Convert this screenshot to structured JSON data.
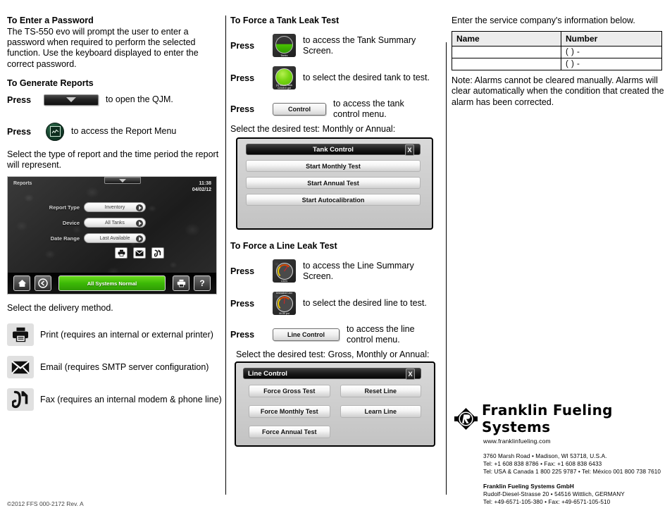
{
  "col1": {
    "password": {
      "heading": "To Enter a Password",
      "body": "The TS-550 evo will prompt the user to enter a password when required to perform the selected function. Use the keyboard displayed to enter the correct password."
    },
    "reports": {
      "heading": "To Generate Reports",
      "press1_label": "Press",
      "press1_after": "to open the QJM.",
      "press2_label": "Press",
      "press2_after": "to access the Report Menu",
      "select_text": "Select the type of report and the time period the report will represent.",
      "delivery_intro": "Select the delivery method."
    },
    "screenshot": {
      "title": "Reports",
      "time": "11:38",
      "date": "04/02/12",
      "fields": [
        {
          "label": "Report Type",
          "value": "Inventory"
        },
        {
          "label": "Device",
          "value": "All Tanks"
        },
        {
          "label": "Date Range",
          "value": "Last Available"
        }
      ],
      "actions": [
        "print-icon",
        "email-icon",
        "fax-icon"
      ],
      "status": "All Systems Normal",
      "bar_buttons": [
        "home-icon",
        "back-icon",
        "status",
        "print-icon",
        "help-icon"
      ],
      "help_label": "?"
    },
    "delivery": [
      {
        "icon": "print-icon",
        "text": "Print (requires an internal or external printer)"
      },
      {
        "icon": "email-icon",
        "text": "Email (requires SMTP server configuration)"
      },
      {
        "icon": "fax-icon",
        "text": "Fax (requires an internal modem & phone line)"
      }
    ]
  },
  "col2": {
    "tank": {
      "heading": "To Force a Tank Leak Test",
      "steps": [
        {
          "label": "Press",
          "after": "to access the Tank Summary Screen."
        },
        {
          "label": "Press",
          "after": "to select the desired tank to test."
        },
        {
          "label": "Press",
          "after": "to access the tank control menu."
        }
      ],
      "tank_icon_caption": "Tanks",
      "tank_sel_caption_top": "(1) West Tank",
      "tank_sel_caption_bottom": "12345.6 gal",
      "control_button": "Control",
      "select_text": "Select the desired test: Monthly or Annual:",
      "dialog": {
        "title": "Tank Control",
        "close": "X",
        "buttons": [
          "Start Monthly Test",
          "Start Annual Test",
          "Start Autocalibration"
        ]
      }
    },
    "line": {
      "heading": "To Force a Line Leak Test",
      "steps": [
        {
          "label": "Press",
          "after": "to access the Line Summary Screen."
        },
        {
          "label": "Press",
          "after": "to select the desired line to test."
        },
        {
          "label": "Press",
          "after": "to access the line control menu."
        }
      ],
      "line_icon_caption": "Lines",
      "line_sel_caption_top": "Unleaded Line",
      "line_sel_caption_bottom": "30.50 psi",
      "control_button": "Line Control",
      "select_text": "Select the desired test: Gross, Monthly or Annual:",
      "dialog": {
        "title": "Line Control",
        "close": "X",
        "buttons_left": [
          "Force Gross Test",
          "Force Monthly Test",
          "Force Annual Test"
        ],
        "buttons_right": [
          "Reset Line",
          "Learn Line"
        ]
      }
    }
  },
  "col3": {
    "intro": "Enter the service company's information below.",
    "table": {
      "headers": [
        "Name",
        "Number"
      ],
      "rows": [
        {
          "name": "",
          "number": "(       )        -"
        },
        {
          "name": "",
          "number": "(       )        -"
        }
      ]
    },
    "note": "Note: Alarms cannot be cleared manually. Alarms will clear automatically when the condition that created the alarm has been corrected.",
    "logo": {
      "name": "Franklin Fueling Systems",
      "url": "www.franklinfueling.com",
      "us_address": "3760 Marsh Road • Madison, WI 53718, U.S.A.",
      "us_tel": "Tel: +1 608 838 8786 • Fax: +1 608 838 6433",
      "us_tel2": "Tel: USA & Canada 1 800 225 9787 • Tel: México 001 800 738 7610",
      "de_name": "Franklin Fueling Systems GmbH",
      "de_address": "Rudolf-Diesel-Strasse 20 • 54516 Wittlich, GERMANY",
      "de_tel": "Tel: +49-6571-105-380 • Fax: +49-6571-105-510"
    }
  },
  "footer": {
    "copyright": "©2012 FFS 000-2172 Rev. A"
  }
}
